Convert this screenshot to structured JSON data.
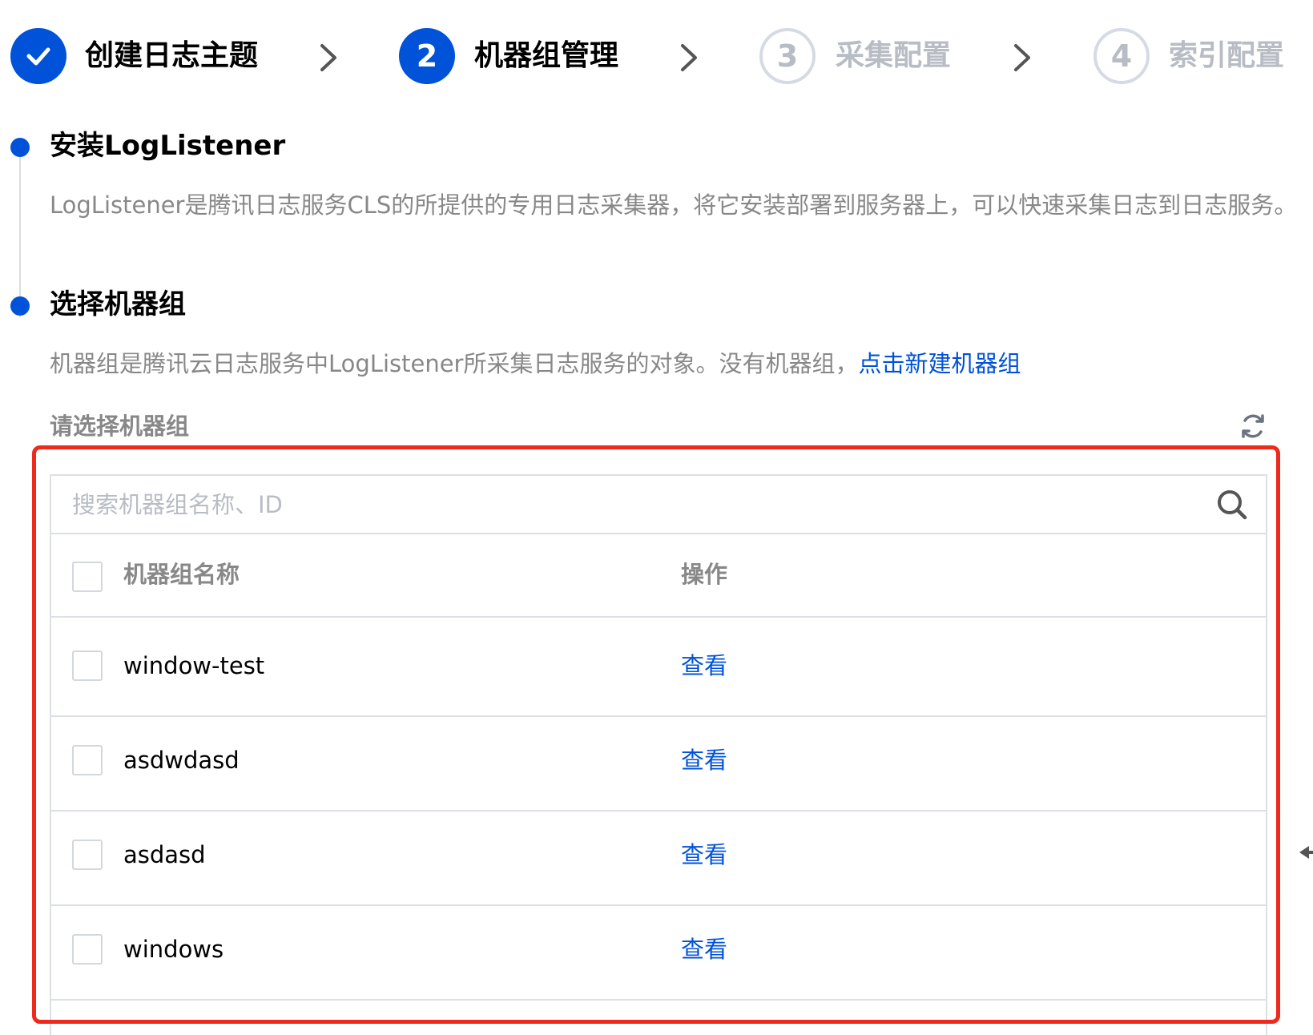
{
  "steps": [
    {
      "number": "",
      "label": "创建日志主题",
      "state": "done",
      "icon": "check-icon"
    },
    {
      "number": "2",
      "label": "机器组管理",
      "state": "active"
    },
    {
      "number": "3",
      "label": "采集配置",
      "state": "pending"
    },
    {
      "number": "4",
      "label": "索引配置",
      "state": "pending"
    }
  ],
  "install": {
    "title": "安装LogListener",
    "description": "LogListener是腾讯日志服务CLS的所提供的专用日志采集器，将它安装部署到服务器上，可以快速采集日志到日志服务。"
  },
  "machine_group": {
    "title": "选择机器组",
    "description": "机器组是腾讯云日志服务中LogListener所采集日志服务的对象。没有机器组，",
    "create_link": "点击新建机器组",
    "select_label": "请选择机器组",
    "search_placeholder": "搜索机器组名称、ID",
    "columns": {
      "name": "机器组名称",
      "action": "操作"
    },
    "rows": [
      {
        "name": "window-test",
        "action": "查看"
      },
      {
        "name": "asdwdasd",
        "action": "查看"
      },
      {
        "name": "asdasd",
        "action": "查看"
      },
      {
        "name": "windows",
        "action": "查看"
      }
    ]
  },
  "colors": {
    "primary": "#0052d9",
    "highlight_border": "#ee2a1c",
    "muted_text": "#888888",
    "pending": "#b8bcc4"
  }
}
